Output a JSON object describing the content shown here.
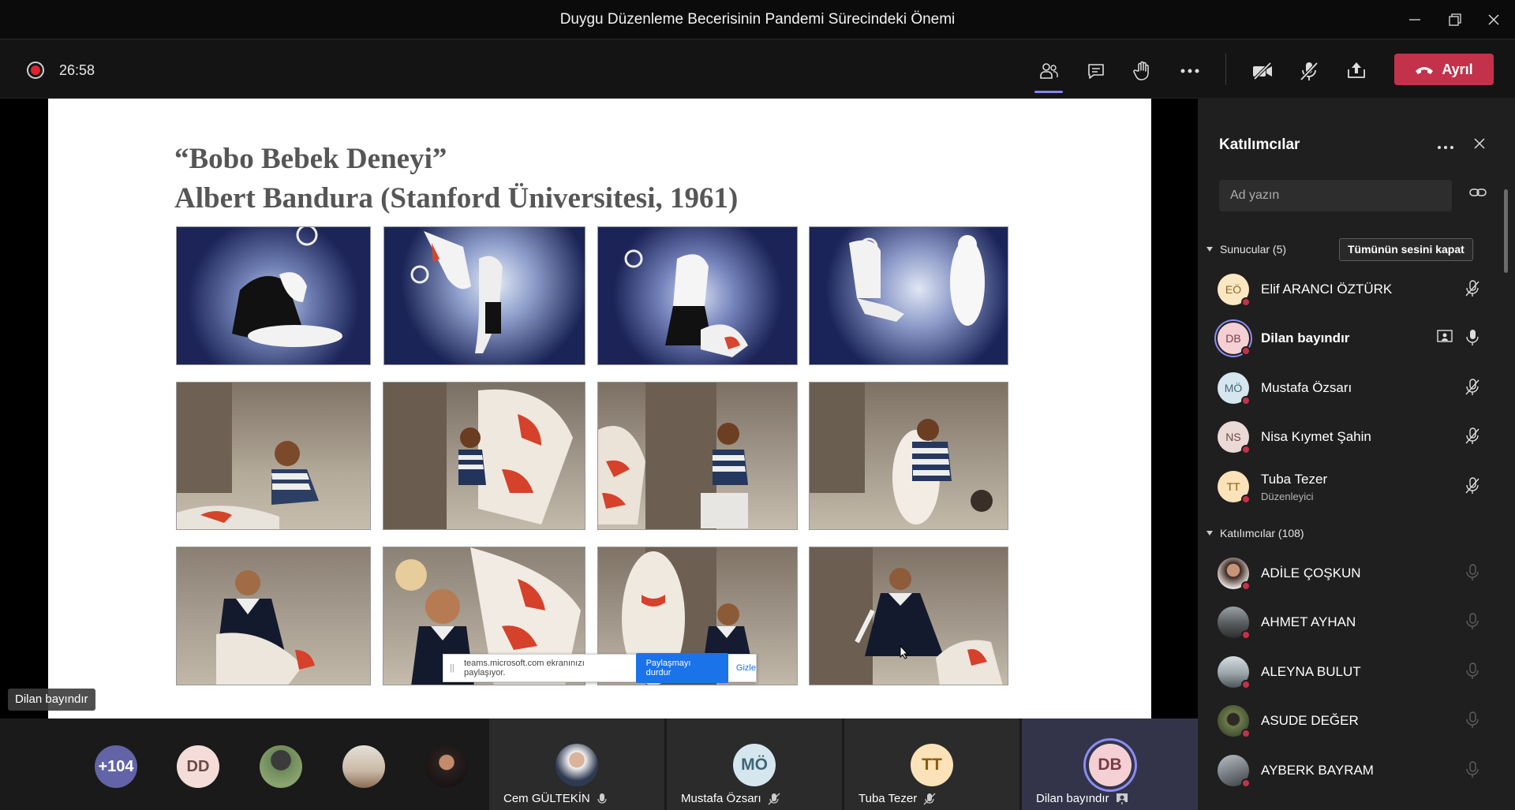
{
  "window": {
    "title": "Duygu Düzenleme Becerisinin Pandemi Sürecindeki Önemi"
  },
  "toolbar": {
    "timer": "26:58",
    "leave_label": "Ayrıl"
  },
  "slide": {
    "title_line1": "“Bobo Bebek Deneyi”",
    "title_line2": "Albert Bandura (Stanford Üniversitesi, 1961)"
  },
  "share_bar": {
    "text": "teams.microsoft.com ekranınızı paylaşıyor.",
    "stop_label": "Paylaşmayı durdur",
    "hide_label": "Gizle"
  },
  "stage": {
    "presenter_name": "Dilan bayındır"
  },
  "gallery": {
    "overflow_count": "+104",
    "dd_initials": "DD",
    "tiles": [
      {
        "name": "Cem GÜLTEKİN",
        "initials": ""
      },
      {
        "name": "Mustafa Özsarı",
        "initials": "MÖ"
      },
      {
        "name": "Tuba Tezer",
        "initials": "TT"
      },
      {
        "name": "Dilan bayındır",
        "initials": "DB"
      }
    ]
  },
  "panel": {
    "title": "Katılımcılar",
    "search_placeholder": "Ad yazın",
    "presenters_header": "Sunucular (5)",
    "mute_all_label": "Tümünün sesini kapat",
    "attendees_header": "Katılımcılar (108)",
    "presenters": [
      {
        "initials": "EÖ",
        "name": "Elif ARANCI ÖZTÜRK",
        "role": ""
      },
      {
        "initials": "DB",
        "name": "Dilan bayındır",
        "role": ""
      },
      {
        "initials": "MÖ",
        "name": "Mustafa Özsarı",
        "role": ""
      },
      {
        "initials": "NS",
        "name": "Nisa Kıymet Şahin",
        "role": ""
      },
      {
        "initials": "TT",
        "name": "Tuba Tezer",
        "role": "Düzenleyici"
      }
    ],
    "attendees": [
      {
        "name": "ADİLE ÇOŞKUN"
      },
      {
        "name": "AHMET AYHAN"
      },
      {
        "name": "ALEYNA BULUT"
      },
      {
        "name": "ASUDE DEĞER"
      },
      {
        "name": "AYBERK BAYRAM"
      }
    ]
  },
  "colors": {
    "accent": "#7f85f5",
    "leave": "#c4314b",
    "record": "#e0242f",
    "panel_bg": "#1f1f1f"
  }
}
